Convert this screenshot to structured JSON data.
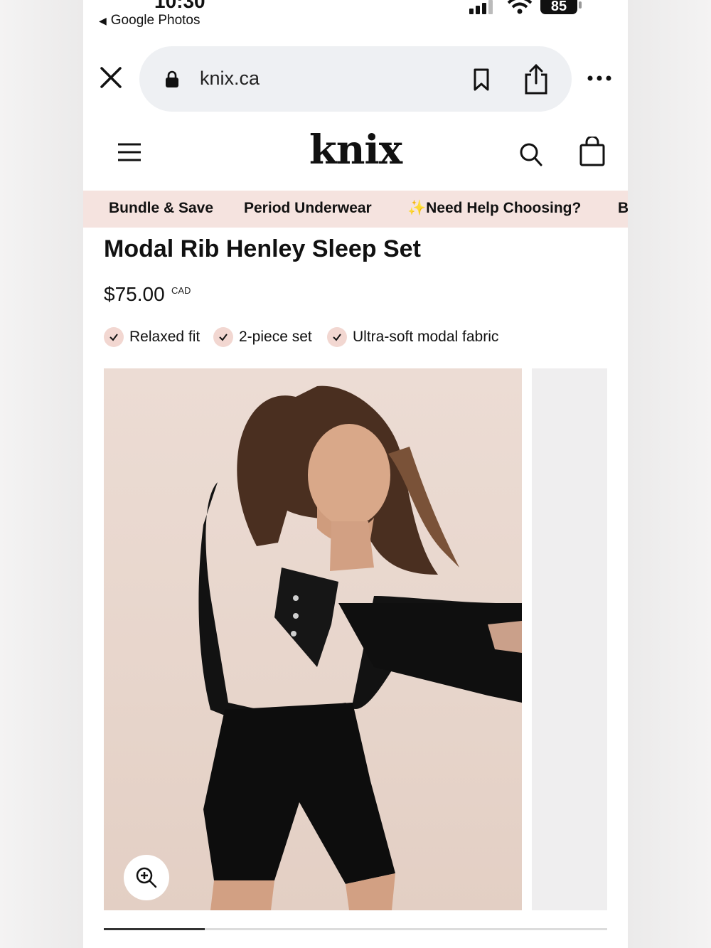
{
  "status_bar": {
    "time_partial": "10:30",
    "back_label": "Google Photos",
    "battery": "85"
  },
  "browser": {
    "url": "knix.ca"
  },
  "site": {
    "logo": "knix",
    "nav": [
      "Bundle & Save",
      "Period Underwear",
      "✨Need Help Choosing?",
      "B"
    ]
  },
  "product": {
    "title": "Modal Rib Henley Sleep Set",
    "price": "$75.00",
    "currency": "CAD",
    "features": [
      "Relaxed fit",
      "2-piece set",
      "Ultra-soft modal fabric"
    ]
  },
  "gallery": {
    "progress": 0.2
  },
  "colors": {
    "nav_bg": "#f5e3df",
    "check_bg": "#f2d7d1",
    "url_bar_bg": "#eef0f3"
  },
  "icons": [
    "close-icon",
    "lock-icon",
    "bookmark-icon",
    "share-icon",
    "more-icon",
    "hamburger-icon",
    "search-icon",
    "shopping-bag-icon",
    "check-icon",
    "zoom-in-icon"
  ]
}
